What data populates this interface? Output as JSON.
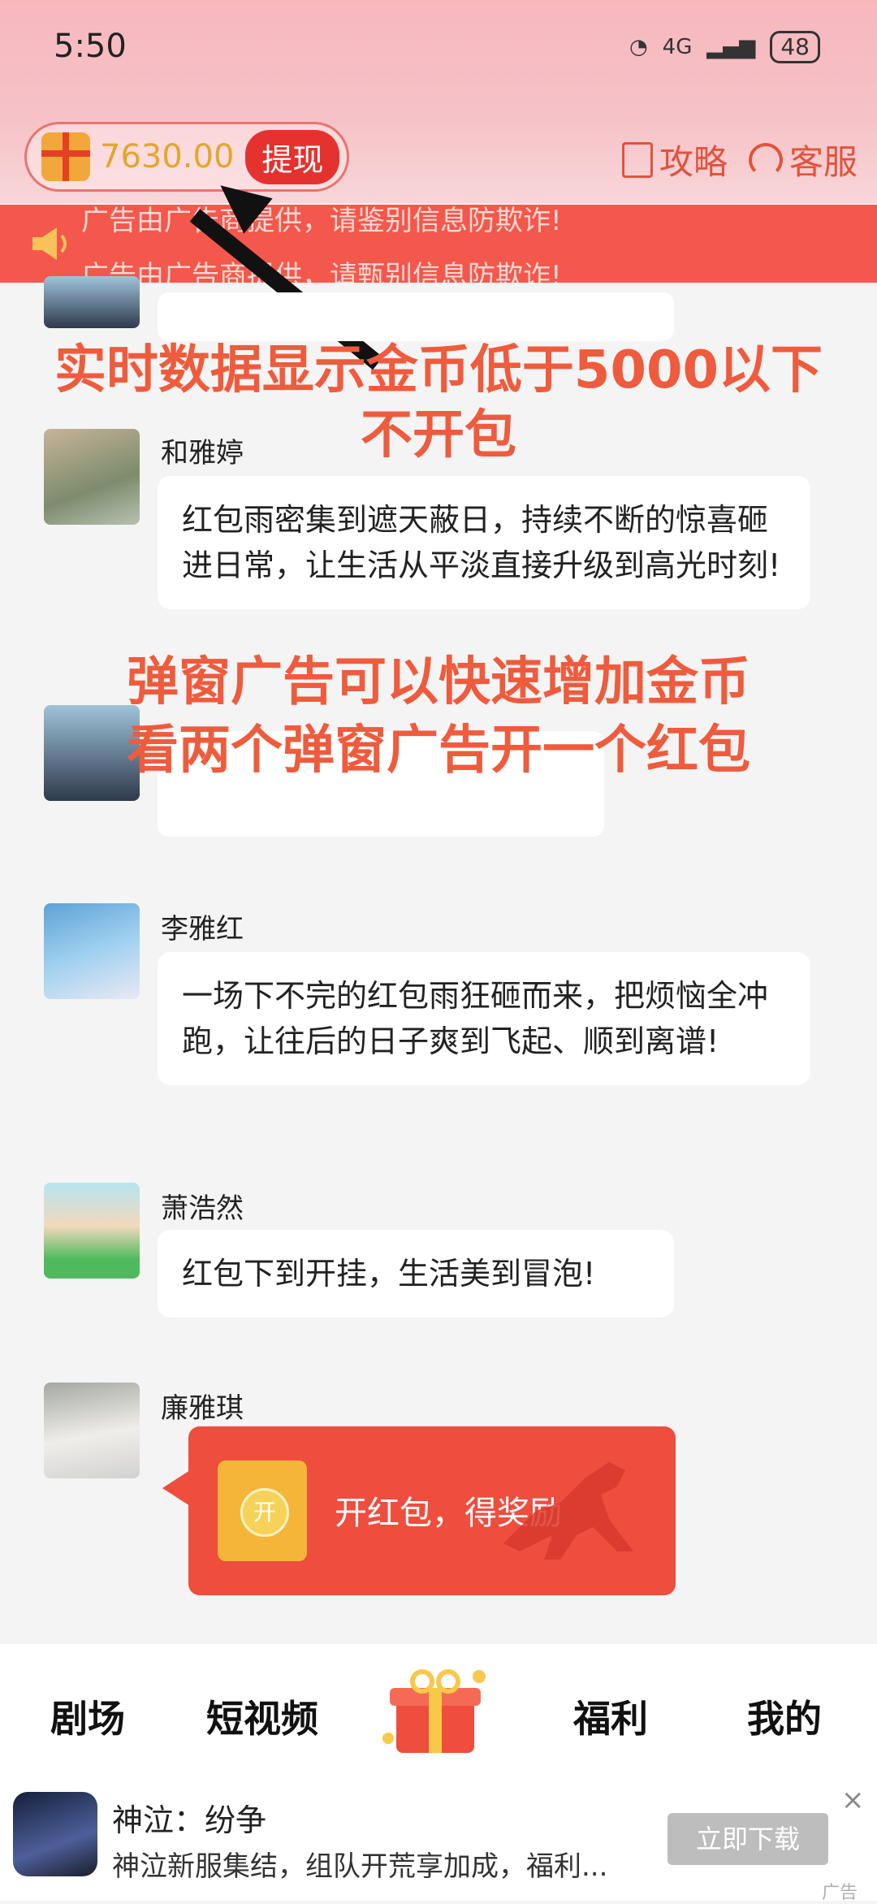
{
  "status": {
    "time": "5:50",
    "network": "4G",
    "battery": "48"
  },
  "header": {
    "coins": "7630.00",
    "withdraw_label": "提现",
    "strategy_label": "攻略",
    "service_label": "客服"
  },
  "notice": {
    "line1": "广告由广告商提供，请鉴别信息防欺诈!",
    "line2": "广告由广告商提供，请甄别信息防欺诈!"
  },
  "annotations": {
    "line1": "实时数据显示金币低于5000以下",
    "line2": "不开包",
    "line3": "弹窗广告可以快速增加金币",
    "line4": "看两个弹窗广告开一个红包"
  },
  "chat": [
    {
      "name": "和雅婷",
      "message": "红包雨密集到遮天蔽日，持续不断的惊喜砸进日常，让生活从平淡直接升级到高光时刻!"
    },
    {
      "name": "李雅红",
      "message": "一场下不完的红包雨狂砸而来，把烦恼全冲跑，让往后的日子爽到飞起、顺到离谱!"
    },
    {
      "name": "萧浩然",
      "message": "红包下到开挂，生活美到冒泡!"
    },
    {
      "name": "廉雅琪",
      "message": ""
    }
  ],
  "red_packet": {
    "icon_char": "开",
    "label": "开红包，得奖励"
  },
  "nav": {
    "theater": "剧场",
    "short_video": "短视频",
    "welfare": "福利",
    "mine": "我的"
  },
  "ad": {
    "title": "神泣：纷争",
    "desc": "神泣新服集结，组队开荒享加成，福利...",
    "button": "立即下载",
    "tag": "广告",
    "close": "×"
  },
  "colors": {
    "accent": "#ef4d3e",
    "annotation": "#ef5b3d",
    "coin": "#e3a62c"
  }
}
